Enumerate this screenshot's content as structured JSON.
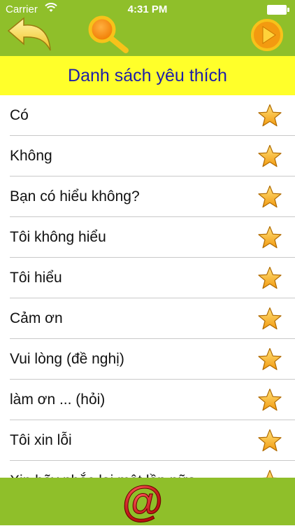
{
  "status_bar": {
    "carrier": "Carrier",
    "time": "4:31 PM",
    "icons": [
      "wifi-icon",
      "battery-icon"
    ]
  },
  "toolbar": {
    "icons": [
      "back-arrow-icon",
      "search-icon",
      "play-icon"
    ]
  },
  "page": {
    "title": "Danh sách yêu thích"
  },
  "favorites": {
    "items": [
      {
        "label": "Có"
      },
      {
        "label": "Không"
      },
      {
        "label": "Bạn có hiểu không?"
      },
      {
        "label": "Tôi không hiểu"
      },
      {
        "label": "Tôi hiểu"
      },
      {
        "label": "Cảm ơn"
      },
      {
        "label": "Vui lòng (đề nghị)"
      },
      {
        "label": "làm ơn ... (hỏi)"
      },
      {
        "label": "Tôi xin lỗi"
      },
      {
        "label": "Xin hãy nhắc lại một lần nữa"
      }
    ],
    "star_icon": "star-icon"
  },
  "footer": {
    "icon": "at-sign-icon"
  },
  "colors": {
    "bar_green": "#8fbf2a",
    "title_yellow": "#ffff2a",
    "title_text": "#1e1ea8",
    "star_orange": "#f2a31c"
  }
}
